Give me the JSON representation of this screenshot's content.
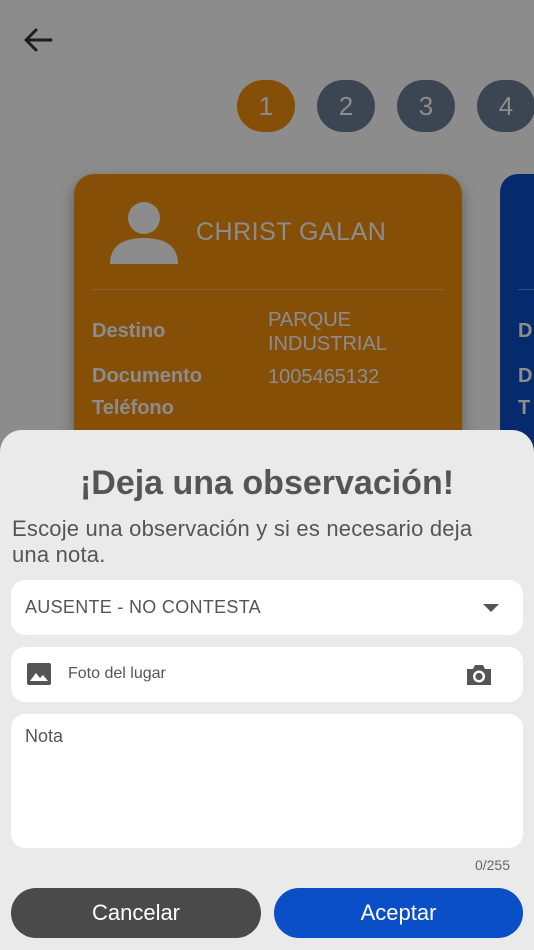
{
  "steps": [
    "1",
    "2",
    "3",
    "4"
  ],
  "card": {
    "name": "CHRIST GALAN",
    "destino_label": "Destino",
    "destino_value": "PARQUE INDUSTRIAL",
    "documento_label": "Documento",
    "documento_value": "1005465132",
    "telefono_label": "Teléfono"
  },
  "card2": {
    "row1": "D",
    "row2": "D",
    "row3": "T"
  },
  "sheet": {
    "title": "¡Deja una observación!",
    "subtitle": "Escoje una observación y si es necesario deja una nota.",
    "select_value": "AUSENTE - NO CONTESTA",
    "photo_label": "Foto del lugar",
    "note_placeholder": "Nota",
    "counter": "0/255",
    "cancel_label": "Cancelar",
    "accept_label": "Aceptar"
  },
  "colors": {
    "accent": "#f5900e",
    "primary": "#0a4fc8",
    "step_inactive": "#6d8097"
  },
  "icons": [
    "back-arrow-icon",
    "person-icon",
    "chevron-down-icon",
    "image-icon",
    "camera-icon"
  ]
}
